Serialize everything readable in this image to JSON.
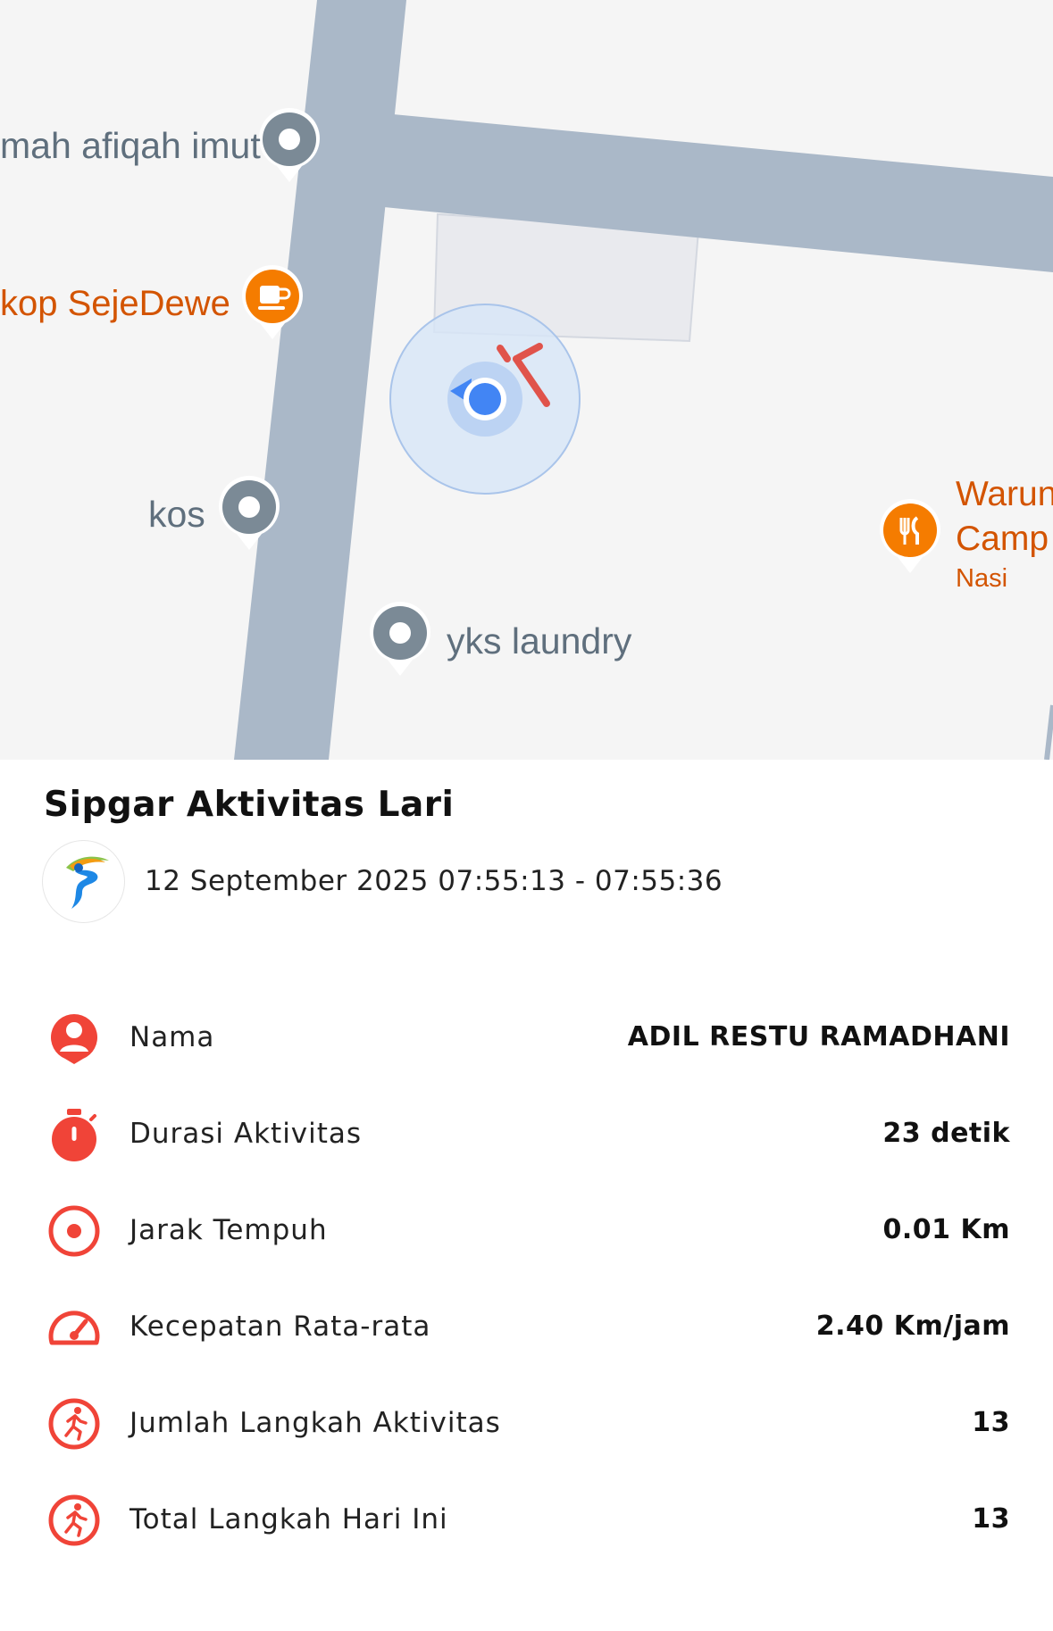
{
  "map": {
    "places": [
      {
        "name": "mah afiqah imut",
        "icon": "place-pin-icon"
      },
      {
        "name": "kop SejeDewe",
        "icon": "coffee-icon"
      },
      {
        "name": "kos",
        "icon": "place-pin-icon"
      },
      {
        "name": "yks laundry",
        "icon": "place-pin-icon"
      },
      {
        "name": "Warun",
        "name2": "Camp",
        "sub": "Nasi",
        "icon": "restaurant-icon"
      }
    ]
  },
  "activity": {
    "title": "Sipgar Aktivitas Lari",
    "datetime": "12 September 2025 07:55:13 - 07:55:36"
  },
  "stats": [
    {
      "label": "Nama",
      "value": "ADIL RESTU RAMADHANI",
      "icon": "person-icon"
    },
    {
      "label": "Durasi Aktivitas",
      "value": "23 detik",
      "icon": "stopwatch-icon"
    },
    {
      "label": "Jarak Tempuh",
      "value": "0.01 Km",
      "icon": "target-icon"
    },
    {
      "label": "Kecepatan Rata-rata",
      "value": "2.40 Km/jam",
      "icon": "speedometer-icon"
    },
    {
      "label": "Jumlah Langkah Aktivitas",
      "value": "13",
      "icon": "runner-icon"
    },
    {
      "label": "Total Langkah Hari Ini",
      "value": "13",
      "icon": "runner-icon"
    }
  ],
  "colors": {
    "accent": "#f04438",
    "road": "#aab8c8",
    "poi_orange": "#f57c00",
    "poi_gray": "#7b8a96",
    "location_blue": "#4285f4"
  }
}
